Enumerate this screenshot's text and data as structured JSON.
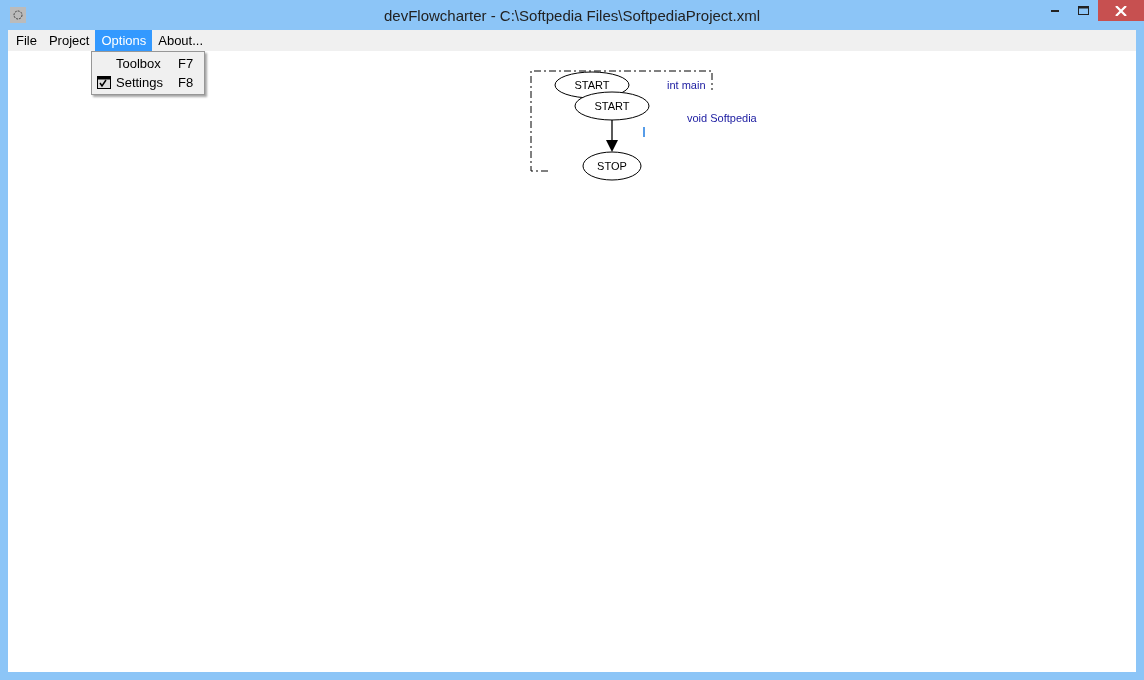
{
  "window": {
    "title": "devFlowcharter - C:\\Softpedia Files\\SoftpediaProject.xml"
  },
  "menu": [
    {
      "label": "File",
      "selected": false
    },
    {
      "label": "Project",
      "selected": false
    },
    {
      "label": "Options",
      "selected": true
    },
    {
      "label": "About...",
      "selected": false
    }
  ],
  "dropdown": [
    {
      "label": "Toolbox",
      "shortcut": "F7",
      "kind": "plain"
    },
    {
      "label": "Settings",
      "shortcut": "F8",
      "kind": "icon"
    }
  ],
  "flowchart": {
    "nodes": [
      {
        "text": "START",
        "kind": "terminal"
      },
      {
        "text": "START",
        "kind": "terminal"
      },
      {
        "text": "STOP",
        "kind": "terminal"
      }
    ],
    "labels": [
      {
        "text": "int main"
      },
      {
        "text": "void Softpedia"
      }
    ]
  }
}
